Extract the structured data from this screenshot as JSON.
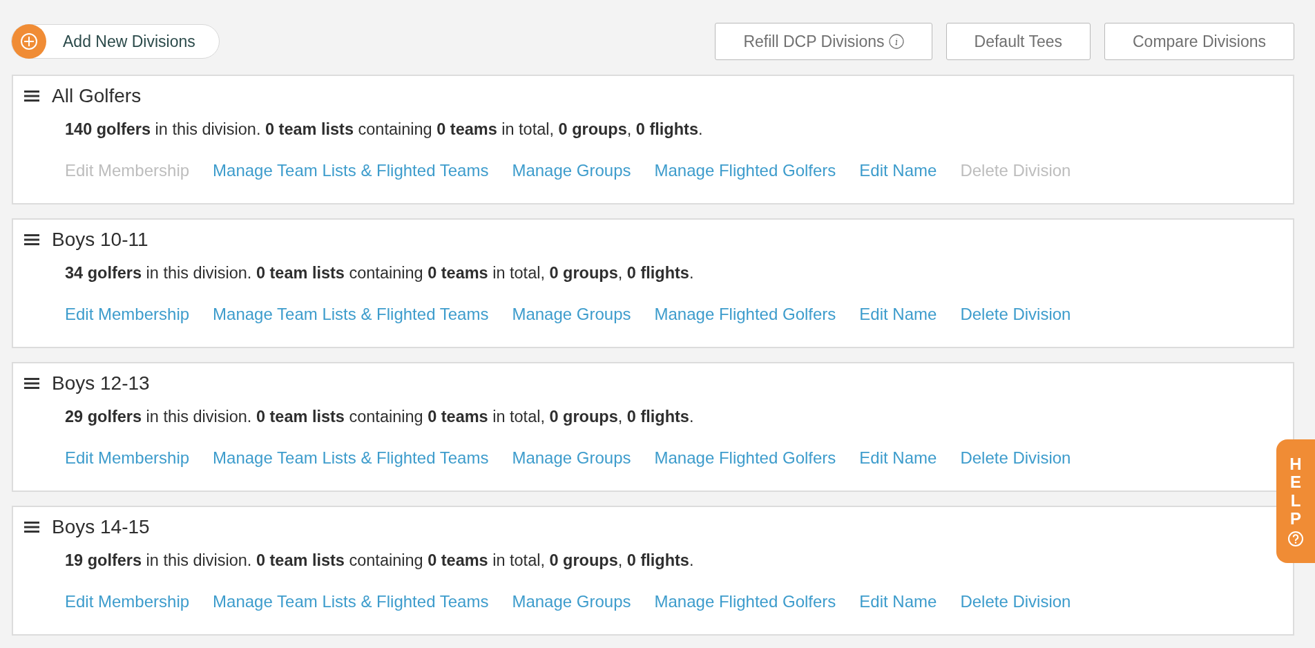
{
  "add_button": {
    "label": "Add New Divisions"
  },
  "toolbar_buttons": [
    {
      "label": "Refill DCP Divisions",
      "info": true
    },
    {
      "label": "Default Tees",
      "info": false
    },
    {
      "label": "Compare Divisions",
      "info": false
    }
  ],
  "divisions": [
    {
      "name": "All Golfers",
      "summary": "**140 golfers** in this division. **0 team lists** containing **0 teams** in total, **0 groups**, **0 flights**.",
      "actions": [
        {
          "label": "Edit Membership",
          "disabled": true
        },
        {
          "label": "Manage Team Lists & Flighted Teams",
          "disabled": false
        },
        {
          "label": "Manage Groups",
          "disabled": false
        },
        {
          "label": "Manage Flighted Golfers",
          "disabled": false
        },
        {
          "label": "Edit Name",
          "disabled": false
        },
        {
          "label": "Delete Division",
          "disabled": true
        }
      ]
    },
    {
      "name": "Boys 10-11",
      "summary": "**34 golfers** in this division. **0 team lists** containing **0 teams** in total, **0 groups**, **0 flights**.",
      "actions": [
        {
          "label": "Edit Membership",
          "disabled": false
        },
        {
          "label": "Manage Team Lists & Flighted Teams",
          "disabled": false
        },
        {
          "label": "Manage Groups",
          "disabled": false
        },
        {
          "label": "Manage Flighted Golfers",
          "disabled": false
        },
        {
          "label": "Edit Name",
          "disabled": false
        },
        {
          "label": "Delete Division",
          "disabled": false
        }
      ]
    },
    {
      "name": "Boys 12-13",
      "summary": "**29 golfers** in this division. **0 team lists** containing **0 teams** in total, **0 groups**, **0 flights**.",
      "actions": [
        {
          "label": "Edit Membership",
          "disabled": false
        },
        {
          "label": "Manage Team Lists & Flighted Teams",
          "disabled": false
        },
        {
          "label": "Manage Groups",
          "disabled": false
        },
        {
          "label": "Manage Flighted Golfers",
          "disabled": false
        },
        {
          "label": "Edit Name",
          "disabled": false
        },
        {
          "label": "Delete Division",
          "disabled": false
        }
      ]
    },
    {
      "name": "Boys 14-15",
      "summary": "**19 golfers** in this division. **0 team lists** containing **0 teams** in total, **0 groups**, **0 flights**.",
      "actions": [
        {
          "label": "Edit Membership",
          "disabled": false
        },
        {
          "label": "Manage Team Lists & Flighted Teams",
          "disabled": false
        },
        {
          "label": "Manage Groups",
          "disabled": false
        },
        {
          "label": "Manage Flighted Golfers",
          "disabled": false
        },
        {
          "label": "Edit Name",
          "disabled": false
        },
        {
          "label": "Delete Division",
          "disabled": false
        }
      ]
    }
  ],
  "help_tab": {
    "label": "HELP"
  }
}
